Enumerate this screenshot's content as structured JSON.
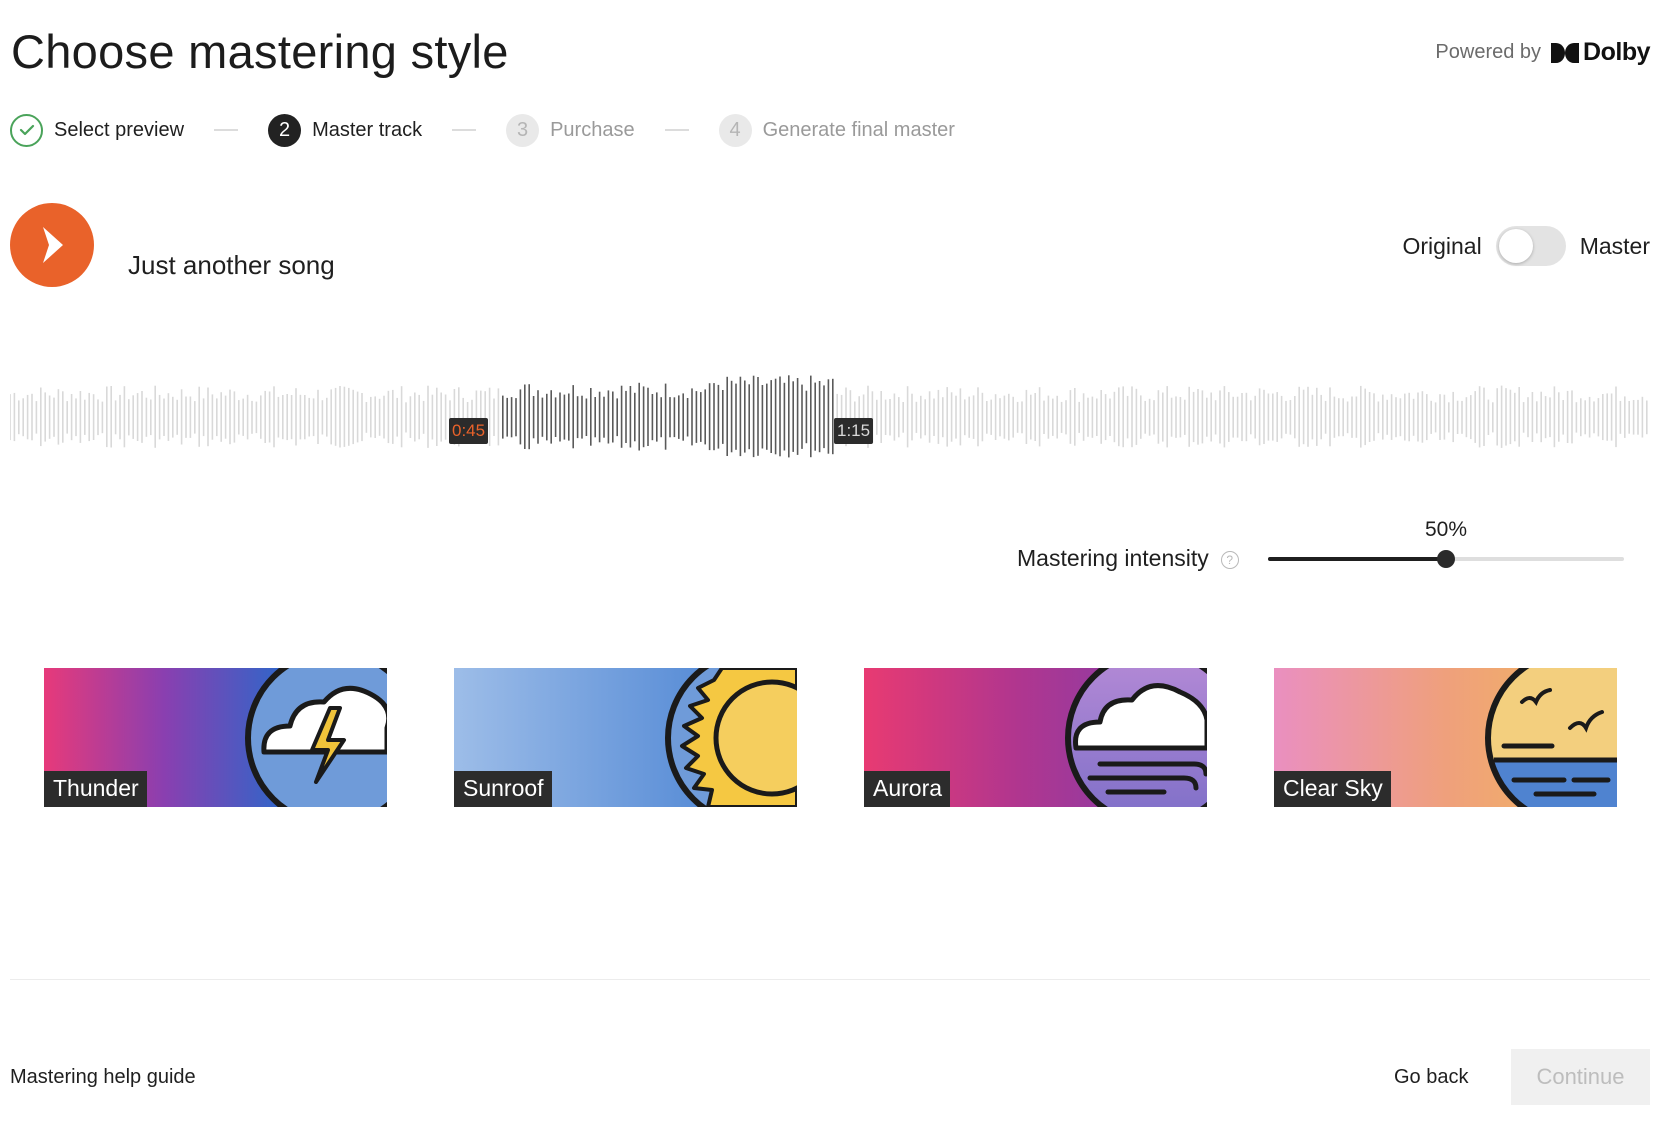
{
  "header": {
    "title": "Choose mastering style",
    "powered_by": "Powered by",
    "brand": "Dolby"
  },
  "stepper": {
    "steps": [
      {
        "number": "",
        "label": "Select preview",
        "state": "done"
      },
      {
        "number": "2",
        "label": "Master track",
        "state": "active"
      },
      {
        "number": "3",
        "label": "Purchase",
        "state": "todo"
      },
      {
        "number": "4",
        "label": "Generate final master",
        "state": "todo"
      }
    ]
  },
  "player": {
    "song_title": "Just another song",
    "toggle_left": "Original",
    "toggle_right": "Master",
    "toggle_state": "Original",
    "selection_start": "0:45",
    "selection_end": "1:15"
  },
  "intensity": {
    "label": "Mastering intensity",
    "help_glyph": "?",
    "value_text": "50%",
    "value": 0.5
  },
  "styles": [
    {
      "name": "Thunder",
      "icon": "thunder-cloud-icon"
    },
    {
      "name": "Sunroof",
      "icon": "sun-icon"
    },
    {
      "name": "Aurora",
      "icon": "wind-cloud-icon"
    },
    {
      "name": "Clear Sky",
      "icon": "sunset-birds-icon"
    }
  ],
  "footer": {
    "help_link": "Mastering help guide",
    "back_label": "Go back",
    "continue_label": "Continue"
  },
  "colors": {
    "accent": "#e9622a",
    "success": "#4aa35a",
    "waveform_inactive": "#d9d9d9",
    "waveform_selected": "#5a5a5a"
  }
}
